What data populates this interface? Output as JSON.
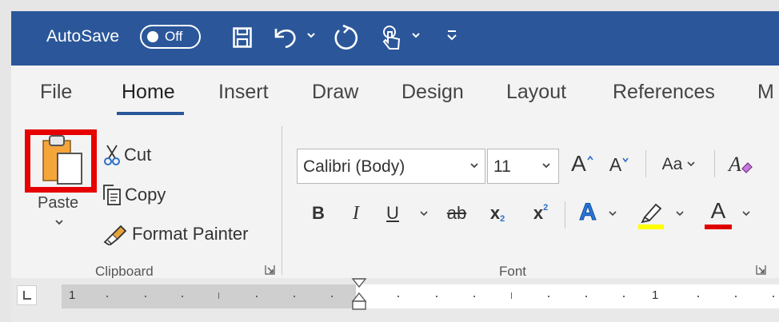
{
  "quick_access": {
    "autosave_label": "AutoSave",
    "autosave_state": "Off",
    "icons": [
      "save-icon",
      "undo-icon",
      "redo-icon",
      "touch-mode-icon",
      "customize-toolbar-icon"
    ]
  },
  "tabs": [
    {
      "label": "File",
      "active": false
    },
    {
      "label": "Home",
      "active": true
    },
    {
      "label": "Insert",
      "active": false
    },
    {
      "label": "Draw",
      "active": false
    },
    {
      "label": "Design",
      "active": false
    },
    {
      "label": "Layout",
      "active": false
    },
    {
      "label": "References",
      "active": false
    },
    {
      "label": "M",
      "active": false
    }
  ],
  "clipboard": {
    "paste_label": "Paste",
    "cut_label": "Cut",
    "copy_label": "Copy",
    "format_painter_label": "Format Painter",
    "group_label": "Clipboard"
  },
  "font": {
    "font_name": "Calibri (Body)",
    "font_size": "11",
    "grow_label": "A",
    "shrink_label": "A",
    "change_case_label": "Aa",
    "bold_label": "B",
    "italic_label": "I",
    "underline_label": "U",
    "strike_label": "ab",
    "subscript_label": "x",
    "subscript_sub": "2",
    "superscript_label": "x",
    "superscript_sup": "2",
    "text_effects_label": "A",
    "font_color_label": "A",
    "group_label": "Font"
  },
  "ruler": {
    "left_number": "1",
    "right_number": "1"
  },
  "colors": {
    "title_bar": "#2b579a",
    "highlight_box": "#e60000",
    "highlight_color": "#ffff00",
    "font_color": "#e00000",
    "text_effects": "#2e75d6"
  }
}
